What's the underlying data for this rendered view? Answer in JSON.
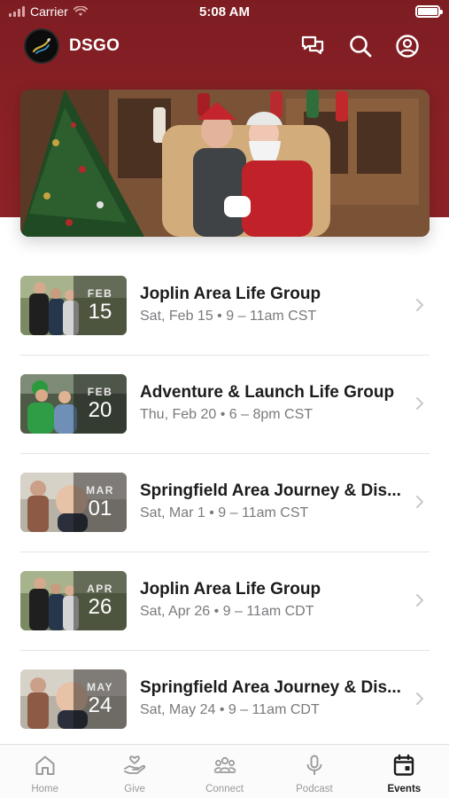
{
  "status_bar": {
    "carrier": "Carrier",
    "time": "5:08 AM"
  },
  "header": {
    "title": "DSGO",
    "icons": [
      "chat-icon",
      "search-icon",
      "account-icon"
    ]
  },
  "hero": {
    "image": "santa-photo-banner"
  },
  "events": [
    {
      "month": "FEB",
      "day": "15",
      "title": "Joplin Area Life Group",
      "subtitle": "Sat, Feb 15 • 9 – 11am CST",
      "thumb": "group-photo-a"
    },
    {
      "month": "FEB",
      "day": "20",
      "title": "Adventure & Launch Life Group",
      "subtitle": "Thu, Feb 20 • 6 – 8pm CST",
      "thumb": "group-photo-b"
    },
    {
      "month": "MAR",
      "day": "01",
      "title": "Springfield Area Journey & Dis...",
      "subtitle": "Sat, Mar 1 • 9 – 11am CST",
      "thumb": "child-photo"
    },
    {
      "month": "APR",
      "day": "26",
      "title": "Joplin Area Life Group",
      "subtitle": "Sat, Apr 26 • 9 – 11am CDT",
      "thumb": "group-photo-a"
    },
    {
      "month": "MAY",
      "day": "24",
      "title": "Springfield Area Journey & Dis...",
      "subtitle": "Sat, May 24 • 9 – 11am CDT",
      "thumb": "child-photo"
    }
  ],
  "tabs": [
    {
      "label": "Home",
      "icon": "home-icon"
    },
    {
      "label": "Give",
      "icon": "give-icon"
    },
    {
      "label": "Connect",
      "icon": "connect-icon"
    },
    {
      "label": "Podcast",
      "icon": "microphone-icon"
    },
    {
      "label": "Events",
      "icon": "calendar-icon",
      "active": true
    }
  ],
  "colors": {
    "brand": "#8a2126",
    "inactive": "#9a9a9e",
    "active": "#1c1c1e"
  }
}
